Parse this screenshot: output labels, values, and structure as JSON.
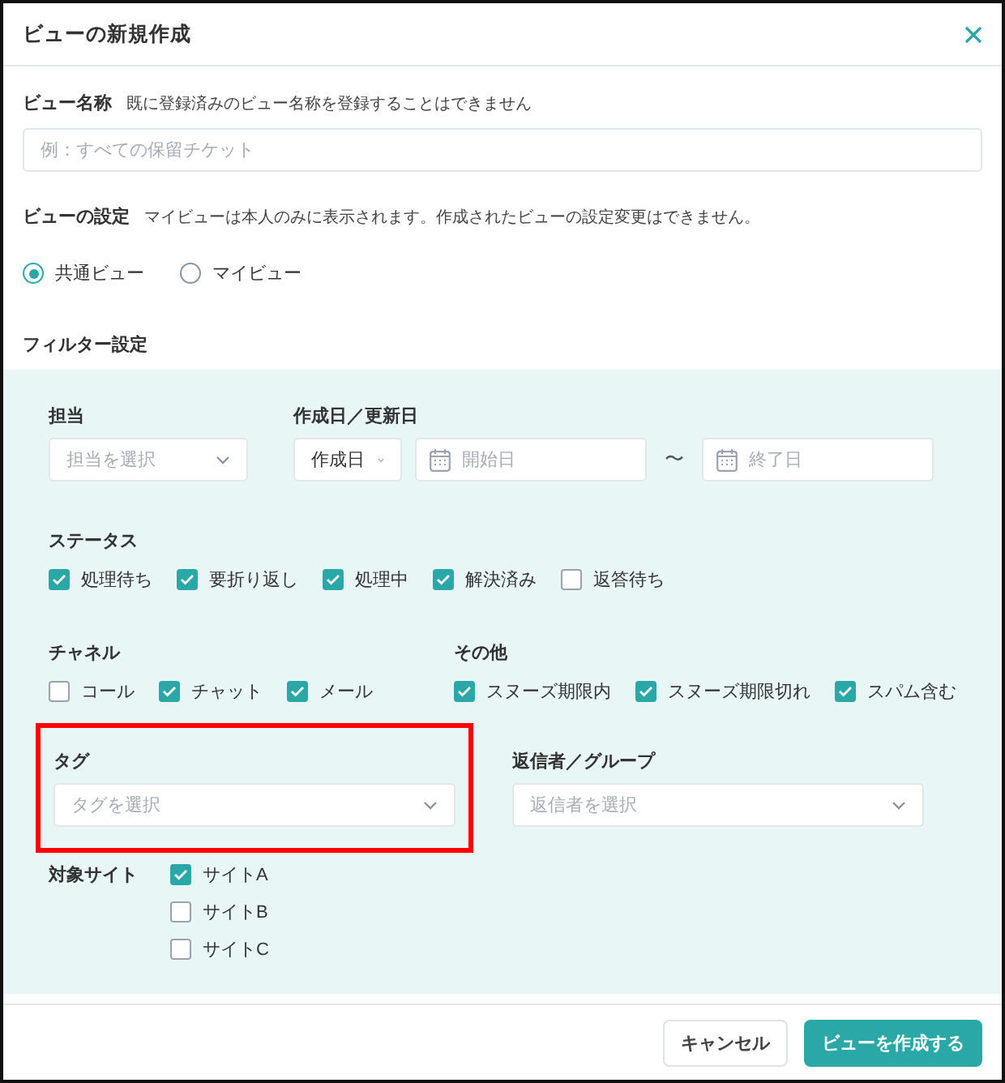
{
  "dialog": {
    "title": "ビューの新規作成"
  },
  "view_name": {
    "label": "ビュー名称",
    "note": "既に登録済みのビュー名称を登録することはできません",
    "placeholder": "例：すべての保留チケット"
  },
  "view_setting": {
    "label": "ビューの設定",
    "note": "マイビューは本人のみに表示されます。作成されたビューの設定変更はできません。",
    "options": [
      {
        "label": "共通ビュー",
        "selected": true
      },
      {
        "label": "マイビュー",
        "selected": false
      }
    ]
  },
  "filter": {
    "title": "フィルター設定",
    "assignee": {
      "label": "担当",
      "placeholder": "担当を選択"
    },
    "date": {
      "label": "作成日／更新日",
      "type_value": "作成日",
      "start_placeholder": "開始日",
      "separator": "〜",
      "end_placeholder": "終了日"
    },
    "status": {
      "label": "ステータス",
      "options": [
        {
          "label": "処理待ち",
          "checked": true
        },
        {
          "label": "要折り返し",
          "checked": true
        },
        {
          "label": "処理中",
          "checked": true
        },
        {
          "label": "解決済み",
          "checked": true
        },
        {
          "label": "返答待ち",
          "checked": false
        }
      ]
    },
    "channel": {
      "label": "チャネル",
      "options": [
        {
          "label": "コール",
          "checked": false
        },
        {
          "label": "チャット",
          "checked": true
        },
        {
          "label": "メール",
          "checked": true
        }
      ]
    },
    "other": {
      "label": "その他",
      "options": [
        {
          "label": "スヌーズ期限内",
          "checked": true
        },
        {
          "label": "スヌーズ期限切れ",
          "checked": true
        },
        {
          "label": "スパム含む",
          "checked": true
        }
      ]
    },
    "tag": {
      "label": "タグ",
      "placeholder": "タグを選択",
      "highlighted": true
    },
    "responder": {
      "label": "返信者／グループ",
      "placeholder": "返信者を選択"
    },
    "sites": {
      "label": "対象サイト",
      "options": [
        {
          "label": "サイトA",
          "checked": true
        },
        {
          "label": "サイトB",
          "checked": false
        },
        {
          "label": "サイトC",
          "checked": false
        }
      ]
    }
  },
  "buttons": [
    {
      "label": "キャンセル",
      "kind": "secondary"
    },
    {
      "label": "ビューを作成する",
      "kind": "primary"
    }
  ]
}
